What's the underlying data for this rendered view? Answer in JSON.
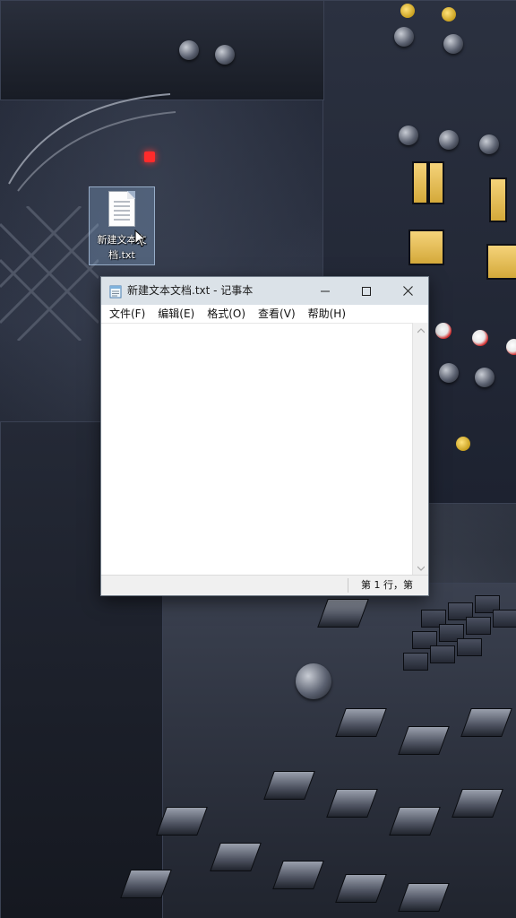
{
  "desktop": {
    "icon": {
      "label": "新建文本文档.txt",
      "icon": "text-file-icon"
    }
  },
  "notepad": {
    "title": "新建文本文档.txt - 记事本",
    "icon": "notepad-icon",
    "controls": {
      "minimize": "minimize-icon",
      "maximize": "maximize-icon",
      "close": "close-icon"
    },
    "menu": [
      {
        "label": "文件(F)"
      },
      {
        "label": "编辑(E)"
      },
      {
        "label": "格式(O)"
      },
      {
        "label": "查看(V)"
      },
      {
        "label": "帮助(H)"
      }
    ],
    "content": "",
    "status": {
      "position": "第 1 行，第"
    }
  },
  "colors": {
    "titlebar": "#dbe2e8",
    "icon_selection": "#96bee8",
    "led": "#ff2b2b",
    "accent_yellow": "#f5d37a"
  }
}
